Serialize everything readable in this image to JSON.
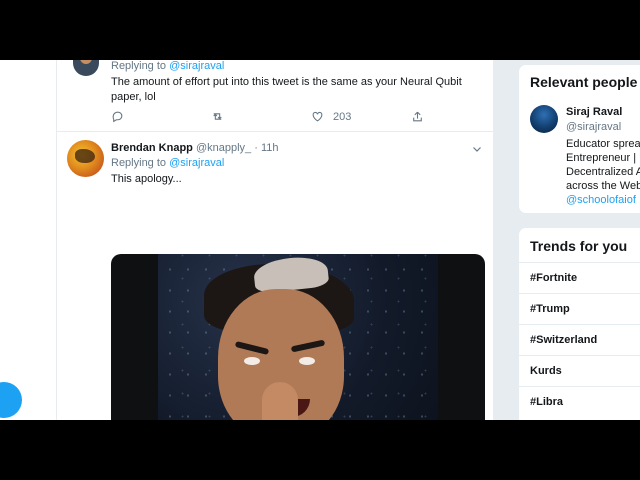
{
  "tweet_top": {
    "replying_prefix": "Replying to",
    "replying_handle": "@sirajraval",
    "text_line1": "The amount of effort put into this tweet is the same as your Neural Qubit",
    "text_line2": "paper, lol",
    "like_count": "203"
  },
  "tweet_main": {
    "author_name": "Brendan Knapp",
    "author_meta": "@knapply_ · 11h",
    "replying_prefix": "Replying to",
    "replying_handle": "@sirajraval",
    "text": "This apology..."
  },
  "relevant_people": {
    "title": "Relevant people",
    "person": {
      "name": "Siraj Raval",
      "handle": "@sirajraval",
      "bio_lines": [
        "Educator sprea",
        "Entrepreneur |",
        "Decentralized A",
        "across the Web",
        "@schoolofaiof"
      ]
    }
  },
  "trends": {
    "title": "Trends for you",
    "items": [
      "#Fortnite",
      "#Trump",
      "#Switzerland",
      "Kurds",
      "#Libra"
    ]
  },
  "colors": {
    "accent": "#1da1f2",
    "text": "#14171a",
    "muted": "#657786",
    "background": "#e6ecf0"
  }
}
